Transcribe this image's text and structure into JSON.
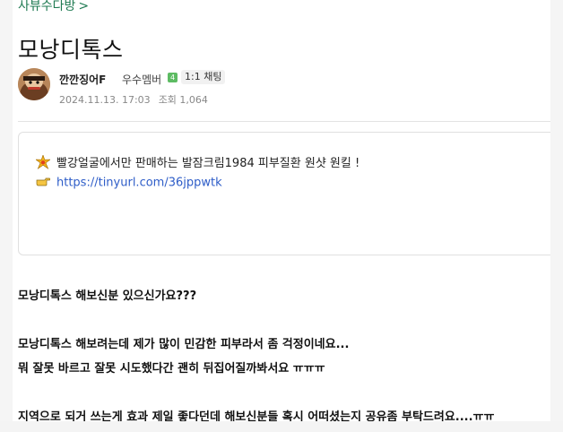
{
  "breadcrumb": {
    "label": "사뷰수다방",
    "chevron": ">"
  },
  "post": {
    "title": "모낭디톡스",
    "author": {
      "nickname": "깐깐징어F",
      "grade": "우수멤버",
      "level_badge": "4",
      "chat_label": "1:1 채팅"
    },
    "date": "2024.11.13. 17:03",
    "views_label": "조회 1,064"
  },
  "ad": {
    "line1": "빨강얼굴에서만 판매하는 발잠크림1984 피부질환 원샷 원킬 !",
    "link": "https://tinyurl.com/36jppwtk"
  },
  "body": {
    "p1": "모낭디톡스 해보신분 있으신가요???",
    "p2": "모낭디톡스 해보려는데 제가 많이 민감한 피부라서 좀 걱정이네요...",
    "p3": "뭐 잘못 바르고 잘못 시도했다간 괜히 뒤집어질까봐서요 ㅠㅠㅠ",
    "p4": "지역으로 되거 쓰는게 효과 제일 좋다던데 해보신분들 혹시 어떠셨는지 공유좀 부탁드려요....ㅠㅠ"
  },
  "icons": {
    "ad_line1": "sparkle-icon",
    "ad_line2": "pointing-hand-icon",
    "avatar": "profile-avatar-image"
  },
  "colors": {
    "breadcrumb": "#1f7a52",
    "link": "#2e5dc8",
    "level_badge": "#5dbb63"
  }
}
